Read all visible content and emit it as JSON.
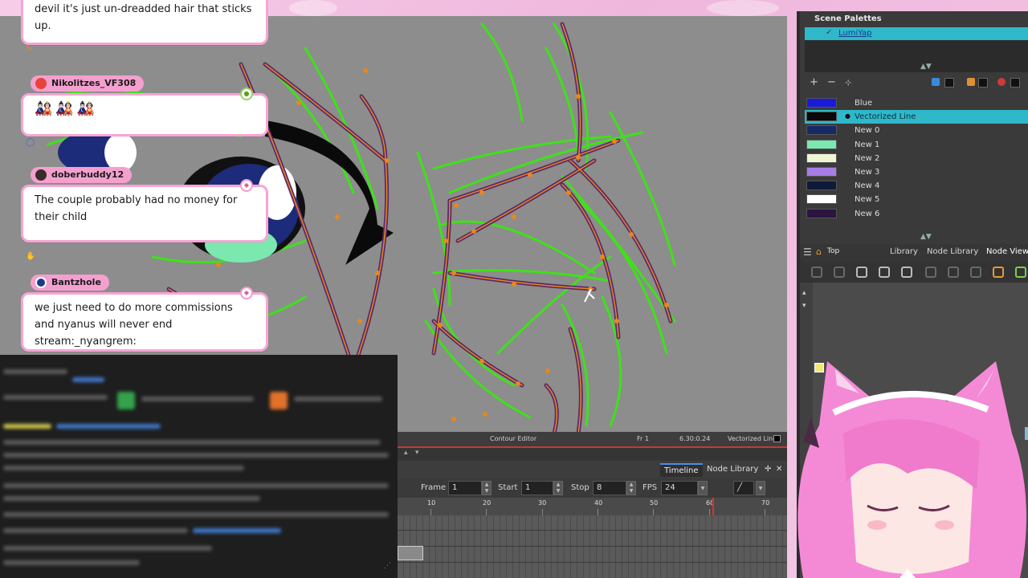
{
  "colors": {
    "accent": "#f6a5d3",
    "canvas_bg": "#8d8d8d",
    "stroke_green": "#3fe11a",
    "stroke_orange": "#e8861f",
    "stroke_purple": "#5a2a6a",
    "selection": "#2fb8c9"
  },
  "chat": {
    "messages": [
      {
        "user": "",
        "text": "devil it's just un-dreadded hair that sticks up."
      },
      {
        "user": "Nikolitzes_VF308",
        "text": "",
        "emotes": [
          "emote-girl-icon",
          "emote-girl-icon",
          "emote-girl-icon"
        ]
      },
      {
        "user": "doberbuddy12",
        "text": "The couple probably had no money for their child"
      },
      {
        "user": "Bantzhole",
        "text": "we just need to do more commissions and nyanus will never end stream:_nyangrem:"
      }
    ]
  },
  "canvas": {
    "status_tool": "Contour Editor",
    "status_frame": "Fr 1",
    "status_coords": "6.30:0.24",
    "status_color": "Vectorized Line"
  },
  "palette_panel": {
    "title": "Scene Palettes",
    "palette_name": "LumiYap",
    "colors": [
      {
        "name": "Blue",
        "hex": "#1a1ad8",
        "selected": false
      },
      {
        "name": "Vectorized Line",
        "hex": "#0a0a0a",
        "selected": true
      },
      {
        "name": "New 0",
        "hex": "#172a66",
        "selected": false
      },
      {
        "name": "New 1",
        "hex": "#7be8b0",
        "selected": false
      },
      {
        "name": "New 2",
        "hex": "#f0f5d4",
        "selected": false
      },
      {
        "name": "New 3",
        "hex": "#a77de8",
        "selected": false
      },
      {
        "name": "New 4",
        "hex": "#0f1a3a",
        "selected": false
      },
      {
        "name": "New 5",
        "hex": "#ffffff",
        "selected": false
      },
      {
        "name": "New 6",
        "hex": "#2a1440",
        "selected": false
      }
    ]
  },
  "node_panel": {
    "top_label": "Top",
    "tabs": [
      "Library",
      "Node Library",
      "Node View"
    ]
  },
  "timeline": {
    "tabs": [
      "Timeline",
      "Node Library"
    ],
    "frame_label": "Frame",
    "frame_value": "1",
    "start_label": "Start",
    "start_value": "1",
    "stop_label": "Stop",
    "stop_value": "8",
    "fps_label": "FPS",
    "fps_value": "24",
    "ruler": [
      "10",
      "20",
      "30",
      "40",
      "50",
      "60",
      "70"
    ]
  }
}
